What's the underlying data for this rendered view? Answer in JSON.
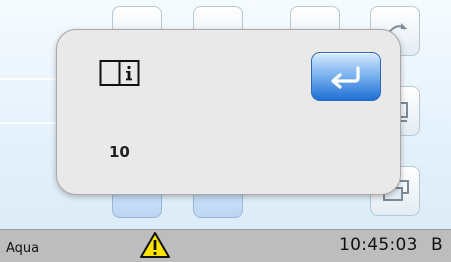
{
  "dialog": {
    "icon": "book-info-icon",
    "value": "10",
    "back_button_icon": "return-arrow-icon"
  },
  "status_bar": {
    "left_text": "Aqua",
    "warning_icon": "warning-triangle-icon",
    "time": "10:45:03",
    "mode": "B"
  },
  "colors": {
    "accent_button": "#1f6fd6",
    "warning": "#ffe400",
    "status_bar": "#bdbdbd"
  }
}
